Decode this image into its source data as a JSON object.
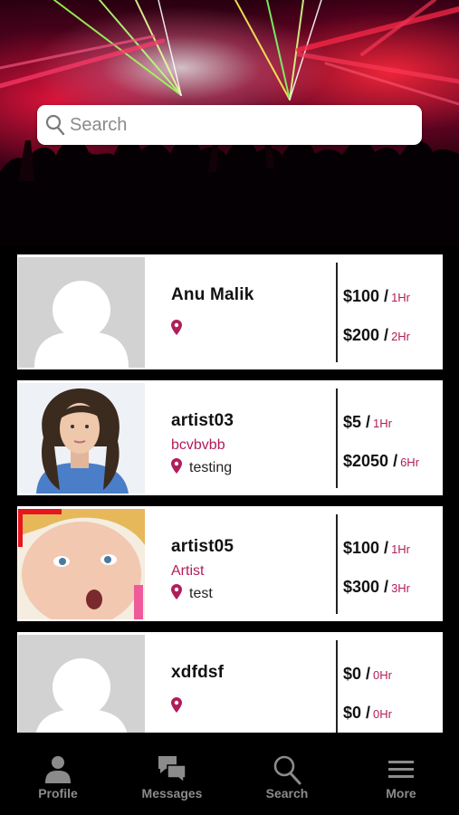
{
  "search": {
    "placeholder": "Search"
  },
  "artists": [
    {
      "name": "Anu Malik",
      "category": "",
      "location": "",
      "photo": "placeholder-avatar",
      "rates": [
        {
          "price": "$100",
          "per": "1Hr"
        },
        {
          "price": "$200",
          "per": "2Hr"
        }
      ]
    },
    {
      "name": "artist03",
      "category": "bcvbvbb",
      "location": "testing",
      "photo": "woman-curly-hair-photo",
      "rates": [
        {
          "price": "$5",
          "per": "1Hr"
        },
        {
          "price": "$2050",
          "per": "6Hr"
        }
      ]
    },
    {
      "name": "artist05",
      "category": "Artist",
      "location": "test",
      "photo": "child-photo",
      "rates": [
        {
          "price": "$100",
          "per": "1Hr"
        },
        {
          "price": "$300",
          "per": "3Hr"
        }
      ]
    },
    {
      "name": "xdfdsf",
      "category": "",
      "location": "",
      "photo": "placeholder-avatar",
      "rates": [
        {
          "price": "$0",
          "per": "0Hr"
        },
        {
          "price": "$0",
          "per": "0Hr"
        }
      ]
    }
  ],
  "tabs": [
    {
      "label": "Profile",
      "icon": "person-icon"
    },
    {
      "label": "Messages",
      "icon": "chat-bubbles-icon"
    },
    {
      "label": "Search",
      "icon": "search-icon"
    },
    {
      "label": "More",
      "icon": "menu-icon"
    }
  ],
  "colors": {
    "accent": "#b01e5a",
    "background": "#000000",
    "tab_label": "#8b8b8b"
  }
}
